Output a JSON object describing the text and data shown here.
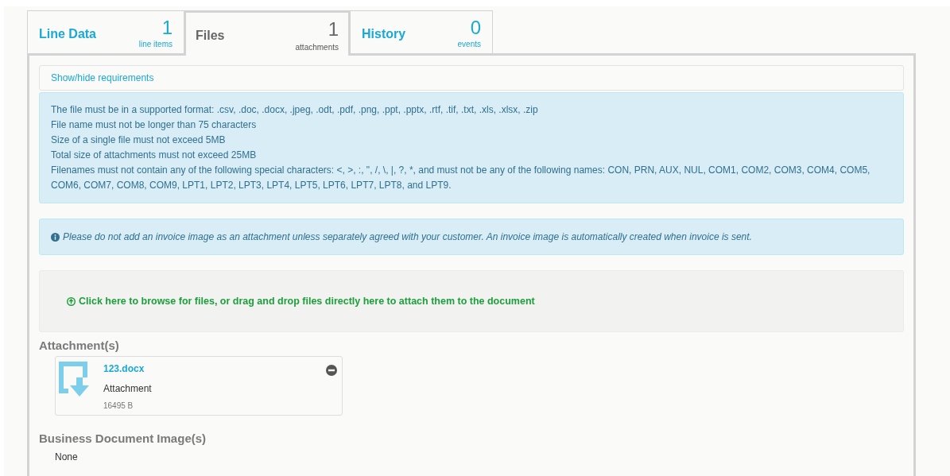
{
  "tabs": [
    {
      "label": "Line Data",
      "count": "1",
      "caption": "line items",
      "selected": false
    },
    {
      "label": "Files",
      "count": "1",
      "caption": "attachments",
      "selected": true
    },
    {
      "label": "History",
      "count": "0",
      "caption": "events",
      "selected": false
    }
  ],
  "requirements_toggle": "Show/hide requirements",
  "requirements": [
    "The file must be in a supported format: .csv, .doc, .docx, .jpeg, .odt, .pdf, .png, .ppt, .pptx, .rtf, .tif, .txt, .xls, .xlsx, .zip",
    "File name must not be longer than 75 characters",
    "Size of a single file must not exceed 5MB",
    "Total size of attachments must not exceed 25MB",
    "Filenames must not contain any of the following special characters: <, >, :, \", /, \\, |, ?, *, and must not be any of the following names: CON, PRN, AUX, NUL, COM1, COM2, COM3, COM4, COM5, COM6, COM7, COM8, COM9, LPT1, LPT2, LPT3, LPT4, LPT5, LPT6, LPT7, LPT8, and LPT9."
  ],
  "notice": "Please do not add an invoice image as an attachment unless separately agreed with your customer. An invoice image is automatically created when invoice is sent.",
  "dropzone": "Click here to browse for files, or drag and drop files directly here to attach them to the document",
  "attachments_heading": "Attachment(s)",
  "attachments": [
    {
      "name": "123.docx",
      "type": "Attachment",
      "size": "16495 B"
    }
  ],
  "images_heading": "Business Document Image(s)",
  "images_empty": "None"
}
